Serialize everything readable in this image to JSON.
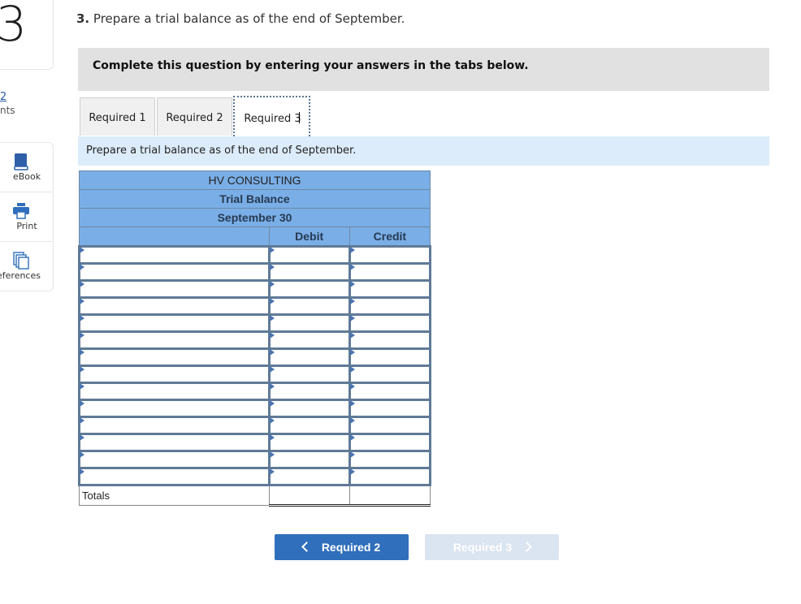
{
  "question": {
    "number": "3",
    "points_value": "2",
    "points_label": "nts",
    "part_number": "3.",
    "prompt": "Prepare a trial balance as of the end of September."
  },
  "tools": [
    {
      "label": "eBook",
      "icon": "book-icon"
    },
    {
      "label": "Print",
      "icon": "printer-icon"
    },
    {
      "label": "eferences",
      "icon": "documents-icon"
    }
  ],
  "instructions": "Complete this question by entering your answers in the tabs below.",
  "tabs": [
    {
      "label": "Required 1",
      "active": false
    },
    {
      "label": "Required 2",
      "active": false
    },
    {
      "label": "Required 3",
      "active": true
    }
  ],
  "subtitle": "Prepare a trial balance as of the end of September.",
  "trial_balance": {
    "company": "HV CONSULTING",
    "title": "Trial Balance",
    "date": "September 30",
    "columns": [
      "",
      "Debit",
      "Credit"
    ],
    "row_count": 14,
    "rows": [
      {
        "account": "",
        "debit": "",
        "credit": ""
      },
      {
        "account": "",
        "debit": "",
        "credit": ""
      },
      {
        "account": "",
        "debit": "",
        "credit": ""
      },
      {
        "account": "",
        "debit": "",
        "credit": ""
      },
      {
        "account": "",
        "debit": "",
        "credit": ""
      },
      {
        "account": "",
        "debit": "",
        "credit": ""
      },
      {
        "account": "",
        "debit": "",
        "credit": ""
      },
      {
        "account": "",
        "debit": "",
        "credit": ""
      },
      {
        "account": "",
        "debit": "",
        "credit": ""
      },
      {
        "account": "",
        "debit": "",
        "credit": ""
      },
      {
        "account": "",
        "debit": "",
        "credit": ""
      },
      {
        "account": "",
        "debit": "",
        "credit": ""
      },
      {
        "account": "",
        "debit": "",
        "credit": ""
      },
      {
        "account": "",
        "debit": "",
        "credit": ""
      }
    ],
    "totals_label": "Totals",
    "totals_debit": "",
    "totals_credit": ""
  },
  "nav": {
    "prev_label": "Required 2",
    "next_label": "Required 3",
    "next_disabled": true
  },
  "colors": {
    "header_blue": "#7aaee6",
    "grid_border": "#5f7a96",
    "primary_button": "#2f6fbb",
    "disabled_button": "#dbe4f1",
    "subtitle_bg": "#dcecfa",
    "instruction_bg": "#e1e1e1"
  }
}
